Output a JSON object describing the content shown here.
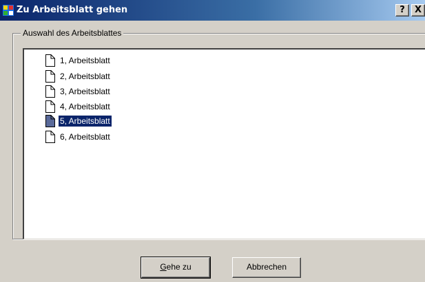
{
  "window": {
    "title": "Zu Arbeitsblatt gehen",
    "help_label": "?",
    "close_label": "X"
  },
  "group": {
    "label": "Auswahl des Arbeitsblattes"
  },
  "sheets": [
    {
      "label": "1, Arbeitsblatt",
      "selected": false
    },
    {
      "label": "2, Arbeitsblatt",
      "selected": false
    },
    {
      "label": "3, Arbeitsblatt",
      "selected": false
    },
    {
      "label": "4, Arbeitsblatt",
      "selected": false
    },
    {
      "label": "5, Arbeitsblatt",
      "selected": true
    },
    {
      "label": "6, Arbeitsblatt",
      "selected": false
    }
  ],
  "buttons": {
    "goto_accel": "G",
    "goto_rest": "ehe zu",
    "cancel_label": "Abbrechen"
  },
  "colors": {
    "selection": "#0a246a",
    "titlebar": "#0a246a"
  }
}
